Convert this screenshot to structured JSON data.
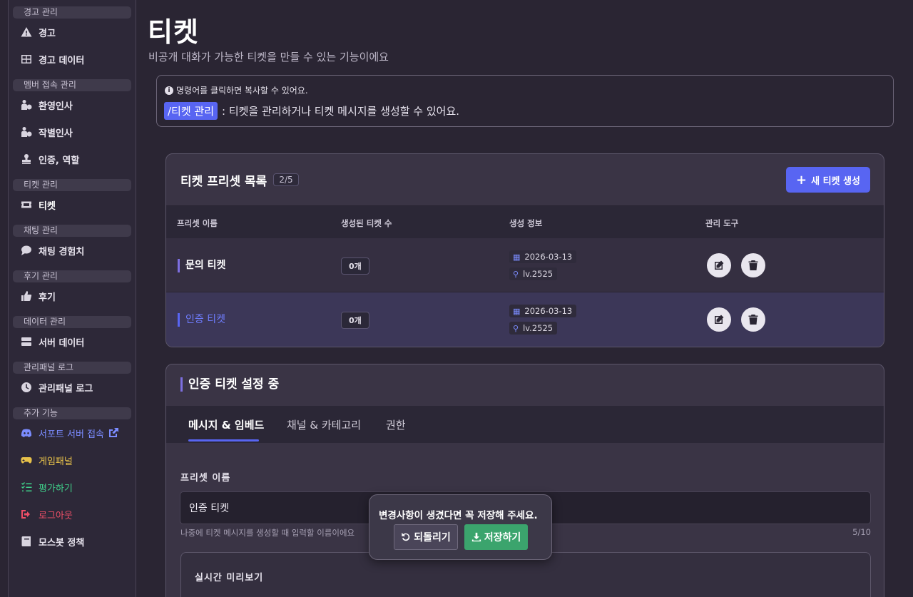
{
  "sidebar": {
    "sections": [
      {
        "title": "경고 관리",
        "items": [
          {
            "label": "경고",
            "icon": "warning-icon"
          },
          {
            "label": "경고 데이터",
            "icon": "table-icon"
          }
        ]
      },
      {
        "title": "멤버 접속 관리",
        "items": [
          {
            "label": "환영인사",
            "icon": "user-plus-icon"
          },
          {
            "label": "작별인사",
            "icon": "user-minus-icon"
          },
          {
            "label": "인증, 역할",
            "icon": "stamp-icon"
          }
        ]
      },
      {
        "title": "티켓 관리",
        "items": [
          {
            "label": "티켓",
            "icon": "ticket-icon"
          }
        ]
      },
      {
        "title": "채팅 관리",
        "items": [
          {
            "label": "채팅 경험치",
            "icon": "chat-icon"
          }
        ]
      },
      {
        "title": "후기 관리",
        "items": [
          {
            "label": "후기",
            "icon": "thumbs-up-icon"
          }
        ]
      },
      {
        "title": "데이터 관리",
        "items": [
          {
            "label": "서버 데이터",
            "icon": "server-icon"
          }
        ]
      },
      {
        "title": "관리패널 로그",
        "items": [
          {
            "label": "관리패널 로그",
            "icon": "clock-icon"
          }
        ]
      },
      {
        "title": "추가 기능",
        "items": [
          {
            "label": "서포트 서버 접속",
            "icon": "discord-icon"
          },
          {
            "label": "게임패널",
            "icon": "gamepad-icon"
          },
          {
            "label": "평가하기",
            "icon": "checklist-icon"
          },
          {
            "label": "로그아웃",
            "icon": "logout-icon"
          },
          {
            "label": "모스봇 정책",
            "icon": "book-icon"
          }
        ]
      }
    ]
  },
  "header": {
    "title": "티켓",
    "subtitle": "비공개 대화가 가능한 티켓을 만들 수 있는 기능이에요"
  },
  "info": {
    "note": "명령어를 클릭하면 복사할 수 있어요.",
    "command": "/티켓 관리",
    "command_desc": ": 티켓을 관리하거나 티켓 메시지를 생성할 수 있어요."
  },
  "presets": {
    "title": "티켓 프리셋 목록",
    "count": "2/5",
    "new_button": "새 티켓 생성",
    "columns": [
      "프리셋 이름",
      "생성된 티켓 수",
      "생성 정보",
      "관리 도구"
    ],
    "rows": [
      {
        "name": "문의 티켓",
        "count": "0개",
        "date": "2026-03-13",
        "user": "lv.2525"
      },
      {
        "name": "인증 티켓",
        "count": "0개",
        "date": "2026-03-13",
        "user": "lv.2525"
      }
    ]
  },
  "settings": {
    "title": "인증 티켓 설정 중",
    "tabs": [
      "메시지 & 임베드",
      "채널 & 카테고리",
      "권한"
    ],
    "active_tab": "메시지 & 임베드",
    "preset_name_label": "프리셋 이름",
    "preset_name_value": "인증 티켓",
    "preset_name_help": "나중에 티켓 메시지를 생성할 때 입력할 이름이에요",
    "preset_name_count": "5/10",
    "preview_title": "실시간 미리보기"
  },
  "save_popup": {
    "message": "변경사항이 생겼다면 꼭 저장해 주세요.",
    "revert_label": "되돌리기",
    "save_label": "저장하기"
  },
  "colors": {
    "accent": "#5865f2",
    "save": "#3ba46d",
    "background": "#2a2533",
    "warning_red": "#ef4f67",
    "yellow": "#e7c14a",
    "green": "#3fd08a"
  }
}
